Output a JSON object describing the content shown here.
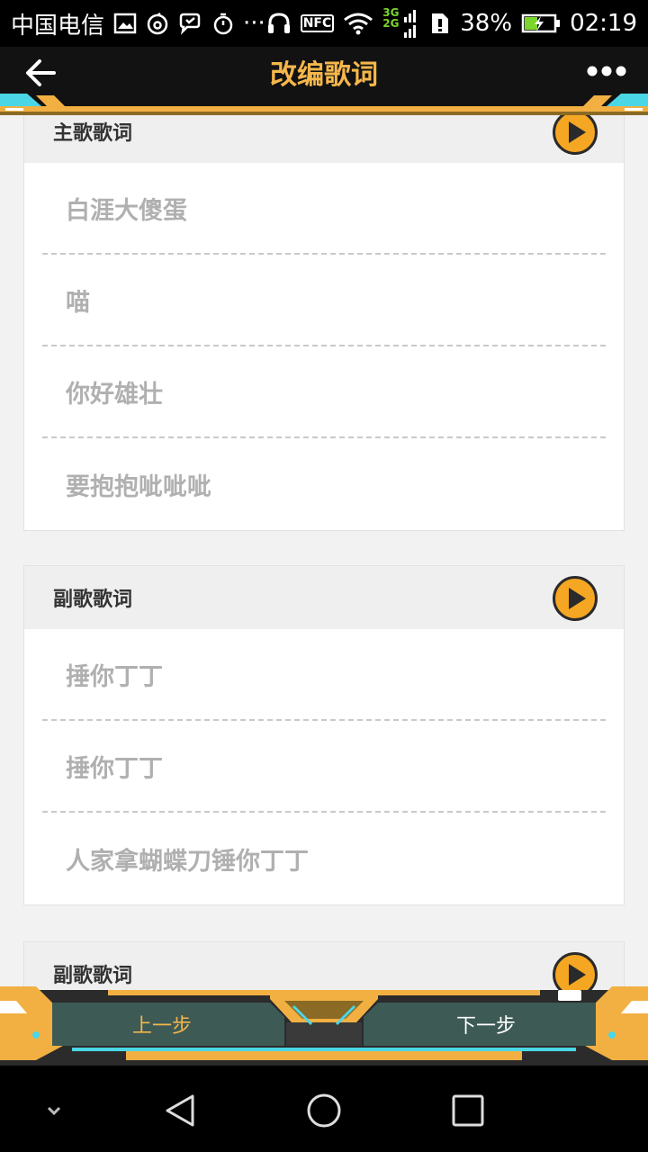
{
  "status_bar": {
    "carrier": "中国电信",
    "network_types": [
      "3G",
      "2G"
    ],
    "battery": "38%",
    "time": "02:19",
    "nfc_label": "NFC",
    "ellipsis": "···"
  },
  "header": {
    "title": "改编歌词"
  },
  "sections": [
    {
      "title": "主歌歌词",
      "lyrics": [
        "白涯大傻蛋",
        "喵",
        "你好雄壮",
        "要抱抱呲呲呲"
      ]
    },
    {
      "title": "副歌歌词",
      "lyrics": [
        "捶你丁丁",
        "捶你丁丁",
        "人家拿蝴蝶刀锤你丁丁"
      ]
    },
    {
      "title": "副歌歌词",
      "lyrics": []
    }
  ],
  "actions": {
    "prev_label": "上一步",
    "next_label": "下一步"
  },
  "colors": {
    "accent": "#f6b74b",
    "play_fill": "#f5a623",
    "header_bg": "#121212",
    "lyric_text": "#b0b0b0",
    "bar_teal": "#3d5a55"
  }
}
